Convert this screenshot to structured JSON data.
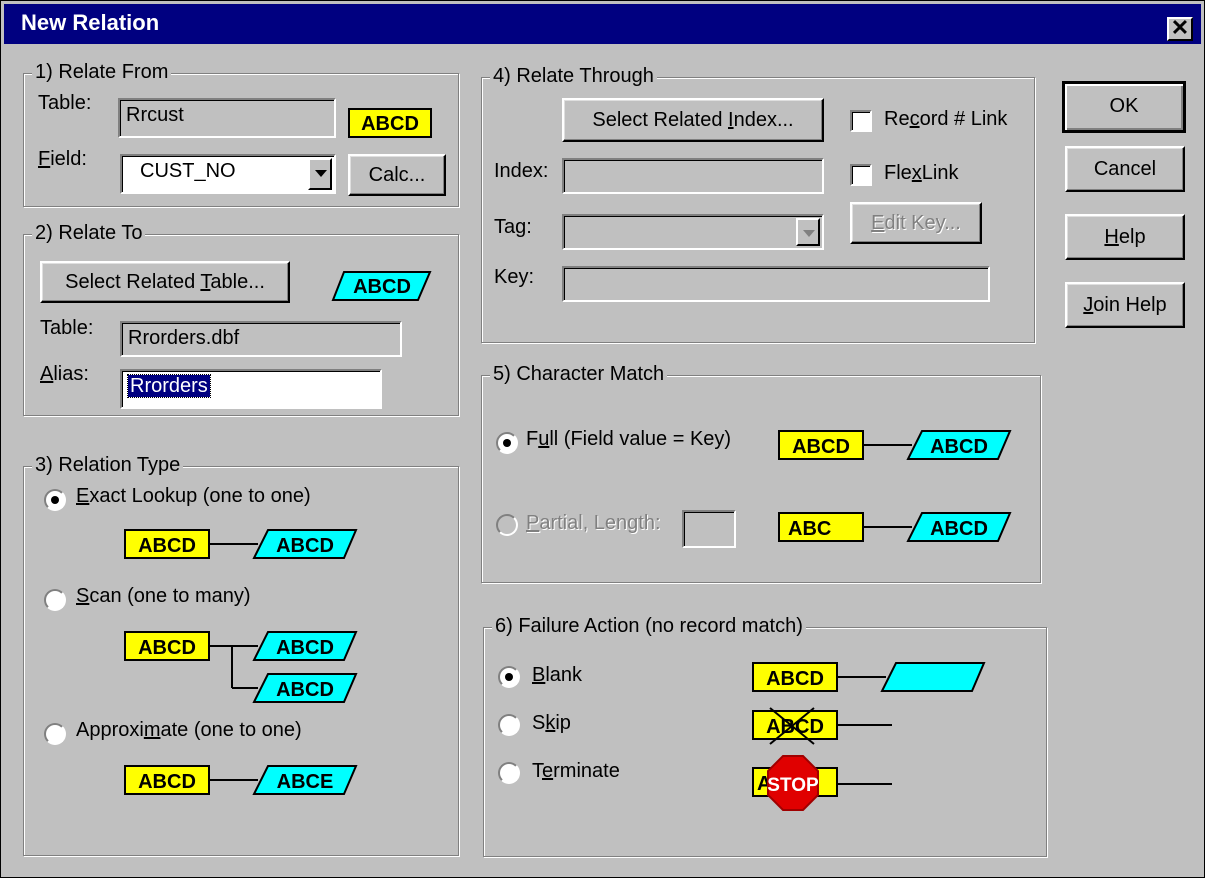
{
  "window": {
    "title": "New Relation",
    "close_glyph": "✕"
  },
  "relate_from": {
    "group_label": "1) Relate From",
    "table_label": "Table:",
    "table_value": "Rrcust",
    "field_label": "Field:",
    "field_value": "CUST_NO",
    "calc_button": "Calc...",
    "badge_text": "ABCD"
  },
  "relate_to": {
    "group_label": "2) Relate To",
    "select_button": "Select Related Table...",
    "badge_text": "ABCD",
    "table_label": "Table:",
    "table_value": "Rrorders.dbf",
    "alias_label": "Alias:",
    "alias_value": "Rrorders"
  },
  "relation_type": {
    "group_label": "3) Relation Type",
    "selected": "exact",
    "options": [
      {
        "label": "Exact Lookup (one to one)",
        "left": "ABCD",
        "right": "ABCD"
      },
      {
        "label": "Scan (one to many)",
        "left": "ABCD",
        "right": "ABCD",
        "right2": "ABCD"
      },
      {
        "label": "Approximate (one to one)",
        "left": "ABCD",
        "right": "ABCE"
      }
    ]
  },
  "relate_through": {
    "group_label": "4) Relate Through",
    "select_index_button": "Select Related Index...",
    "record_link_label": "Record # Link",
    "record_link_checked": false,
    "flexlink_label": "FlexLink",
    "flexlink_checked": false,
    "index_label": "Index:",
    "index_value": "",
    "tag_label": "Tag:",
    "tag_value": "",
    "edit_key_button": "Edit Key...",
    "key_label": "Key:",
    "key_value": ""
  },
  "character_match": {
    "group_label": "5) Character Match",
    "selected": "full",
    "full_label": "Full (Field value = Key)",
    "full_left": "ABCD",
    "full_right": "ABCD",
    "partial_label": "Partial, Length:",
    "partial_length": "",
    "partial_left": "ABC",
    "partial_right": "ABCD"
  },
  "failure_action": {
    "group_label": "6) Failure Action (no record match)",
    "selected": "blank",
    "blank_label": "Blank",
    "skip_label": "Skip",
    "terminate_label": "Terminate",
    "badge_text": "ABCD",
    "stop_text": "STOP"
  },
  "buttons": {
    "ok": "OK",
    "cancel": "Cancel",
    "help": "Help",
    "join_help": "Join Help"
  },
  "colors": {
    "yellow_badge": "#ffff00",
    "cyan_badge": "#00ffff",
    "stop_red": "#e00000",
    "title_bar": "#000080"
  }
}
